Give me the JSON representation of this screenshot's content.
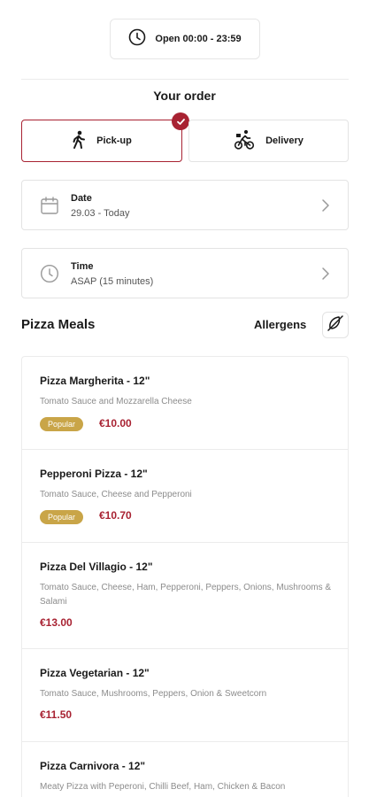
{
  "header": {
    "hours": "Open 00:00 - 23:59",
    "order_title": "Your order"
  },
  "order_mode": {
    "pickup_label": "Pick-up",
    "delivery_label": "Delivery",
    "selected": "pickup"
  },
  "date_card": {
    "label": "Date",
    "value": "29.03 - Today"
  },
  "time_card": {
    "label": "Time",
    "value": "ASAP (15 minutes)"
  },
  "menu": {
    "section_title": "Pizza Meals",
    "allergens_label": "Allergens",
    "items": [
      {
        "name": "Pizza Margherita - 12\"",
        "description": "Tomato Sauce and Mozzarella Cheese",
        "badge": "Popular",
        "price": "€10.00"
      },
      {
        "name": "Pepperoni Pizza - 12\"",
        "description": "Tomato Sauce, Cheese and Pepperoni",
        "badge": "Popular",
        "price": "€10.70"
      },
      {
        "name": "Pizza Del Villagio - 12\"",
        "description": "Tomato Sauce, Cheese, Ham, Pepperoni, Peppers, Onions, Mushrooms & Salami",
        "badge": "",
        "price": "€13.00"
      },
      {
        "name": "Pizza Vegetarian - 12\"",
        "description": "Tomato Sauce, Mushrooms, Peppers, Onion & Sweetcorn",
        "badge": "",
        "price": "€11.50"
      },
      {
        "name": "Pizza Carnivora - 12\"",
        "description": "Meaty Pizza with Peperoni, Chilli Beef, Ham, Chicken & Bacon",
        "badge": "",
        "price": ""
      }
    ]
  },
  "colors": {
    "accent": "#a82232",
    "badge": "#c9a548",
    "border": "#e3e3e3",
    "muted_text": "#8c8c8c"
  },
  "icons": [
    "clock-icon",
    "walking-person-icon",
    "check-icon",
    "cyclist-icon",
    "calendar-icon",
    "chevron-right-icon",
    "no-allergens-icon"
  ]
}
